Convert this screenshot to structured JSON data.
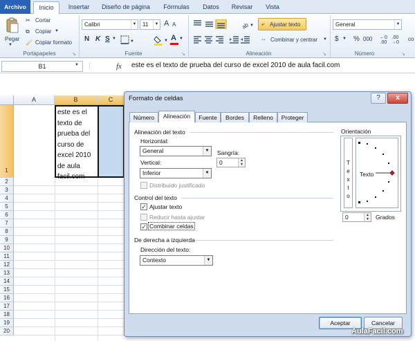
{
  "ribbon": {
    "tabs": [
      "Archivo",
      "Inicio",
      "Insertar",
      "Diseño de página",
      "Fórmulas",
      "Datos",
      "Revisar",
      "Vista"
    ],
    "clipboard": {
      "paste": "Pegar",
      "cut": "Cortar",
      "copy": "Copiar",
      "copy_format": "Copiar formato",
      "title": "Portapapeles"
    },
    "font": {
      "name": "Calibri",
      "size": "11",
      "grow": "A",
      "shrink": "A",
      "bold": "N",
      "italic": "K",
      "underline": "S",
      "font_color_letter": "A",
      "title": "Fuente"
    },
    "alignment": {
      "wrap_text": "Ajustar texto",
      "merge_center": "Combinar y centrar",
      "title": "Alineación"
    },
    "number": {
      "format": "General",
      "currency": "$",
      "percent": "%",
      "thousands": "000",
      "title": "Número"
    },
    "styles_partial": "co"
  },
  "formula_bar": {
    "name_box": "B1",
    "fx": "fx",
    "content": "este es el texto de prueba del curso de excel 2010 de aula facil.com"
  },
  "sheet": {
    "columns": [
      "A",
      "B",
      "C"
    ],
    "rows": [
      "1",
      "2",
      "3",
      "4",
      "5",
      "6",
      "7",
      "8",
      "9",
      "10",
      "11",
      "12",
      "13",
      "14",
      "15",
      "16",
      "17",
      "18",
      "19",
      "20"
    ],
    "b1_lines": [
      "este es el",
      "texto de",
      "prueba del",
      "curso de",
      "excel 2010",
      "de aula",
      "facil.com"
    ]
  },
  "dialog": {
    "title": "Formato de celdas",
    "help": "?",
    "close": "x",
    "tabs": [
      "Número",
      "Alineación",
      "Fuente",
      "Bordes",
      "Relleno",
      "Proteger"
    ],
    "active_tab": "Alineación",
    "text_alignment": {
      "section": "Alineación del texto",
      "horizontal_label": "Horizontal:",
      "horizontal_value": "General",
      "vertical_label": "Vertical:",
      "vertical_value": "Inferior",
      "indent_label": "Sangría:",
      "indent_value": "0",
      "distributed": "Distribuido justificado"
    },
    "text_control": {
      "section": "Control del texto",
      "wrap": "Ajustar texto",
      "wrap_checked": true,
      "shrink": "Reducir hasta ajustar",
      "shrink_checked": false,
      "merge": "Combinar celdas",
      "merge_checked": true
    },
    "rtl": {
      "section": "De derecha a izquierda",
      "direction_label": "Dirección del texto:",
      "direction_value": "Contexto"
    },
    "orientation": {
      "section": "Orientación",
      "vertical_letters": [
        "T",
        "e",
        "x",
        "t",
        "o"
      ],
      "dial_label": "Texto",
      "degrees_value": "0",
      "degrees_label": "Grados"
    },
    "buttons": {
      "ok": "Aceptar",
      "cancel": "Cancelar"
    }
  },
  "watermark": "AulaFacil.com"
}
